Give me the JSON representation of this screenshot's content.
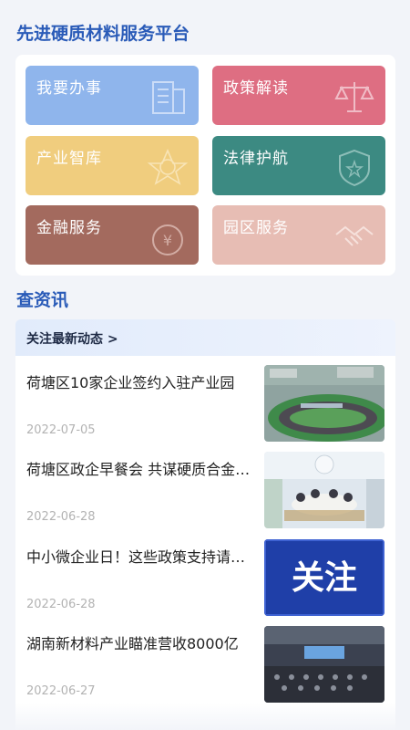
{
  "platform": {
    "title": "先进硬质材料服务平台"
  },
  "services": [
    {
      "label": "我要办事",
      "icon": "building-document-icon",
      "color": "#8fb5ec"
    },
    {
      "label": "政策解读",
      "icon": "scales-icon",
      "color": "#de6e82"
    },
    {
      "label": "产业智库",
      "icon": "network-star-icon",
      "color": "#f0cd7e"
    },
    {
      "label": "法律护航",
      "icon": "shield-star-icon",
      "color": "#3c8a82"
    },
    {
      "label": "金融服务",
      "icon": "money-bag-icon",
      "color": "#a36a5e"
    },
    {
      "label": "园区服务",
      "icon": "handshake-icon",
      "color": "#e7bdb4"
    }
  ],
  "news_section": {
    "title": "查资讯",
    "tab_label": "关注最新动态 >"
  },
  "news": [
    {
      "title": "荷塘区10家企业签约入驻产业园",
      "date": "2022-07-05",
      "image": "industrial-park-aerial-photo"
    },
    {
      "title": "荷塘区政企早餐会 共谋硬质合金产业发展",
      "date": "2022-06-28",
      "image": "meeting-photo"
    },
    {
      "title": "中小微企业日！这些政策支持请收好",
      "date": "2022-06-28",
      "image_text": "关注",
      "image": "attention-banner"
    },
    {
      "title": "湖南新材料产业瞄准营收8000亿",
      "date": "2022-06-27",
      "image": "conference-hall-photo"
    }
  ]
}
